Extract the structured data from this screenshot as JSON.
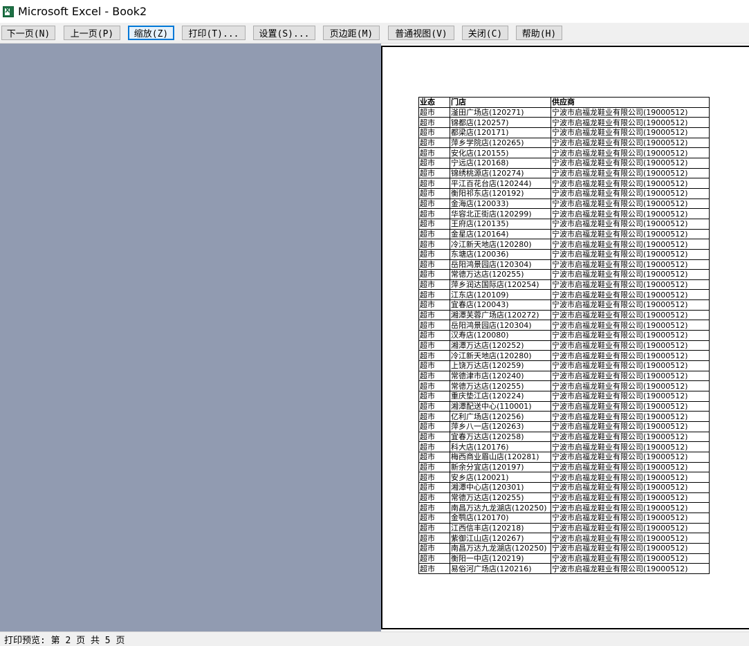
{
  "window": {
    "title": "Microsoft Excel - Book2",
    "app_icon": "excel-icon"
  },
  "toolbar": {
    "next_page": "下一页(N)",
    "prev_page": "上一页(P)",
    "zoom": "缩放(Z)",
    "print": "打印(T)...",
    "setup": "设置(S)...",
    "margins": "页边距(M)",
    "normal_view": "普通视图(V)",
    "close": "关闭(C)",
    "help": "帮助(H)"
  },
  "table": {
    "headers": [
      "业态",
      "门店",
      "供应商"
    ],
    "rows": [
      [
        "超市",
        "滏田广场店(120271)",
        "宁波市启福龙鞋业有限公司(19000512)"
      ],
      [
        "超市",
        "锦都店(120257)",
        "宁波市启福龙鞋业有限公司(19000512)"
      ],
      [
        "超市",
        "都梁店(120171)",
        "宁波市启福龙鞋业有限公司(19000512)"
      ],
      [
        "超市",
        "萍乡学院店(120265)",
        "宁波市启福龙鞋业有限公司(19000512)"
      ],
      [
        "超市",
        "安化店(120155)",
        "宁波市启福龙鞋业有限公司(19000512)"
      ],
      [
        "超市",
        "宁远店(120168)",
        "宁波市启福龙鞋业有限公司(19000512)"
      ],
      [
        "超市",
        "锦绣桃源店(120274)",
        "宁波市启福龙鞋业有限公司(19000512)"
      ],
      [
        "超市",
        "平江百花台店(120244)",
        "宁波市启福龙鞋业有限公司(19000512)"
      ],
      [
        "超市",
        "衡阳祁东店(120192)",
        "宁波市启福龙鞋业有限公司(19000512)"
      ],
      [
        "超市",
        "金海店(120033)",
        "宁波市启福龙鞋业有限公司(19000512)"
      ],
      [
        "超市",
        "华容北正街店(120299)",
        "宁波市启福龙鞋业有限公司(19000512)"
      ],
      [
        "超市",
        "王府店(120135)",
        "宁波市启福龙鞋业有限公司(19000512)"
      ],
      [
        "超市",
        "金星店(120164)",
        "宁波市启福龙鞋业有限公司(19000512)"
      ],
      [
        "超市",
        "冷江新天地店(120280)",
        "宁波市启福龙鞋业有限公司(19000512)"
      ],
      [
        "超市",
        "东塘店(120036)",
        "宁波市启福龙鞋业有限公司(19000512)"
      ],
      [
        "超市",
        "岳阳鸿景园店(120304)",
        "宁波市启福龙鞋业有限公司(19000512)"
      ],
      [
        "超市",
        "常德万达店(120255)",
        "宁波市启福龙鞋业有限公司(19000512)"
      ],
      [
        "超市",
        "萍乡润达国际店(120254)",
        "宁波市启福龙鞋业有限公司(19000512)"
      ],
      [
        "超市",
        "江东店(120109)",
        "宁波市启福龙鞋业有限公司(19000512)"
      ],
      [
        "超市",
        "宜春店(120043)",
        "宁波市启福龙鞋业有限公司(19000512)"
      ],
      [
        "超市",
        "湘潭芙蓉广场店(120272)",
        "宁波市启福龙鞋业有限公司(19000512)"
      ],
      [
        "超市",
        "岳阳鸿景园店(120304)",
        "宁波市启福龙鞋业有限公司(19000512)"
      ],
      [
        "超市",
        "汉寿店(120080)",
        "宁波市启福龙鞋业有限公司(19000512)"
      ],
      [
        "超市",
        "湘潭万达店(120252)",
        "宁波市启福龙鞋业有限公司(19000512)"
      ],
      [
        "超市",
        "冷江新天地店(120280)",
        "宁波市启福龙鞋业有限公司(19000512)"
      ],
      [
        "超市",
        "上饶万达店(120259)",
        "宁波市启福龙鞋业有限公司(19000512)"
      ],
      [
        "超市",
        "常德津市店(120240)",
        "宁波市启福龙鞋业有限公司(19000512)"
      ],
      [
        "超市",
        "常德万达店(120255)",
        "宁波市启福龙鞋业有限公司(19000512)"
      ],
      [
        "超市",
        "重庆垫江店(120224)",
        "宁波市启福龙鞋业有限公司(19000512)"
      ],
      [
        "超市",
        "湘潭配送中心(110001)",
        "宁波市启福龙鞋业有限公司(19000512)"
      ],
      [
        "超市",
        "亿利广场店(120256)",
        "宁波市启福龙鞋业有限公司(19000512)"
      ],
      [
        "超市",
        "萍乡八一店(120263)",
        "宁波市启福龙鞋业有限公司(19000512)"
      ],
      [
        "超市",
        "宜春万达店(120258)",
        "宁波市启福龙鞋业有限公司(19000512)"
      ],
      [
        "超市",
        "科大店(120176)",
        "宁波市启福龙鞋业有限公司(19000512)"
      ],
      [
        "超市",
        "梅西商业眉山店(120281)",
        "宁波市启福龙鞋业有限公司(19000512)"
      ],
      [
        "超市",
        "新余分宜店(120197)",
        "宁波市启福龙鞋业有限公司(19000512)"
      ],
      [
        "超市",
        "安乡店(120021)",
        "宁波市启福龙鞋业有限公司(19000512)"
      ],
      [
        "超市",
        "湘潭中心店(120301)",
        "宁波市启福龙鞋业有限公司(19000512)"
      ],
      [
        "超市",
        "常德万达店(120255)",
        "宁波市启福龙鞋业有限公司(19000512)"
      ],
      [
        "超市",
        "南昌万达九龙湖店(120250)",
        "宁波市启福龙鞋业有限公司(19000512)"
      ],
      [
        "超市",
        "金鹗店(120170)",
        "宁波市启福龙鞋业有限公司(19000512)"
      ],
      [
        "超市",
        "江西信丰店(120218)",
        "宁波市启福龙鞋业有限公司(19000512)"
      ],
      [
        "超市",
        "紫御江山店(120267)",
        "宁波市启福龙鞋业有限公司(19000512)"
      ],
      [
        "超市",
        "南昌万达九龙湖店(120250)",
        "宁波市启福龙鞋业有限公司(19000512)"
      ],
      [
        "超市",
        "衡阳一中店(120219)",
        "宁波市启福龙鞋业有限公司(19000512)"
      ],
      [
        "超市",
        "易俗河广场店(120216)",
        "宁波市启福龙鞋业有限公司(19000512)"
      ]
    ]
  },
  "status": {
    "text": "打印预览: 第 2 页  共 5 页"
  }
}
